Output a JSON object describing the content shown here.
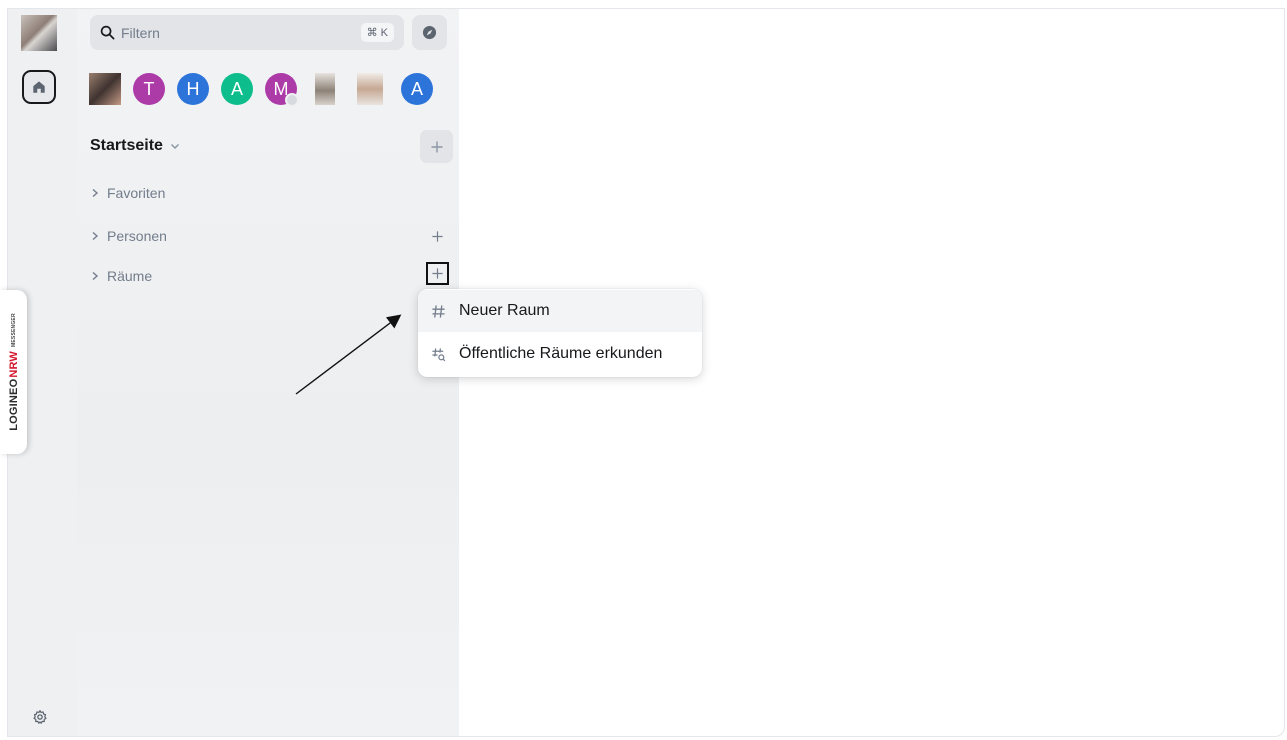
{
  "filter": {
    "placeholder": "Filtern",
    "shortcut": "⌘ K"
  },
  "recents": [
    {
      "kind": "photo",
      "icon": "user-photo"
    },
    {
      "kind": "letter",
      "letter": "T",
      "color": "#ac3ba8"
    },
    {
      "kind": "letter",
      "letter": "H",
      "color": "#2d74da"
    },
    {
      "kind": "letter",
      "letter": "A",
      "color": "#0dbd8b"
    },
    {
      "kind": "letter",
      "letter": "M",
      "color": "#ac3ba8",
      "presence": true
    },
    {
      "kind": "photo",
      "icon": "user-photo"
    },
    {
      "kind": "photo",
      "icon": "user-photo"
    },
    {
      "kind": "letter",
      "letter": "A",
      "color": "#2d74da"
    }
  ],
  "space": {
    "title": "Startseite"
  },
  "sections": [
    {
      "label": "Favoriten"
    },
    {
      "label": "Personen"
    },
    {
      "label": "Räume"
    }
  ],
  "menu": {
    "items": [
      {
        "label": "Neuer Raum",
        "icon": "hash-icon"
      },
      {
        "label": "Öffentliche Räume erkunden",
        "icon": "hash-search-icon"
      }
    ]
  },
  "brand": {
    "part1": "LOGINEO",
    "part2": "NRW",
    "sub": "MESSENGER"
  },
  "colors": {
    "accent": "#0dbd8b",
    "text_primary": "#17191c",
    "text_secondary": "#737d8c",
    "brand_red": "#d3172e"
  }
}
